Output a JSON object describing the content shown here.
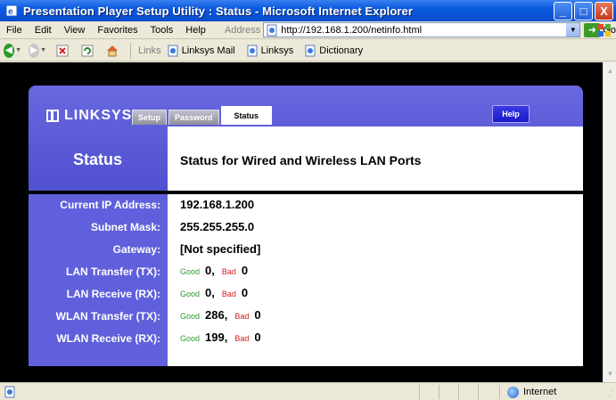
{
  "window": {
    "title": "Presentation Player Setup Utility : Status - Microsoft Internet Explorer",
    "minimize": "_",
    "maximize": "□",
    "close": "X"
  },
  "menu": {
    "items": [
      "File",
      "Edit",
      "View",
      "Favorites",
      "Tools",
      "Help"
    ],
    "address_label": "Address",
    "address_value": "http://192.168.1.200/netinfo.html",
    "go_label": "Go"
  },
  "toolbar": {
    "links_label": "Links",
    "links": [
      "Linksys Mail",
      "Linksys",
      "Dictionary"
    ]
  },
  "page": {
    "logo_text": "LINKSYS",
    "logo_reg": "®",
    "tabs": [
      "Setup",
      "Password",
      "Status"
    ],
    "active_tab": "Status",
    "help_label": "Help",
    "section_title": "Status",
    "header_text": "Status for Wired and Wireless LAN Ports",
    "good_label": "Good",
    "bad_label": "Bad",
    "rows": [
      {
        "label": "Current IP Address:",
        "value": "192.168.1.200"
      },
      {
        "label": "Subnet Mask:",
        "value": "255.255.255.0"
      },
      {
        "label": "Gateway:",
        "value": "[Not specified]"
      },
      {
        "label": "LAN Transfer (TX):",
        "good": "0",
        "bad": "0"
      },
      {
        "label": "LAN Receive (RX):",
        "good": "0",
        "bad": "0"
      },
      {
        "label": "WLAN Transfer (TX):",
        "good": "286",
        "bad": "0"
      },
      {
        "label": "WLAN Receive (RX):",
        "good": "199",
        "bad": "0"
      }
    ]
  },
  "statusbar": {
    "zone": "Internet"
  },
  "colors": {
    "title_bar": "#0a5adf",
    "linksys_purple": "#6060dc",
    "good": "#2a9a2a",
    "bad": "#d02020"
  }
}
